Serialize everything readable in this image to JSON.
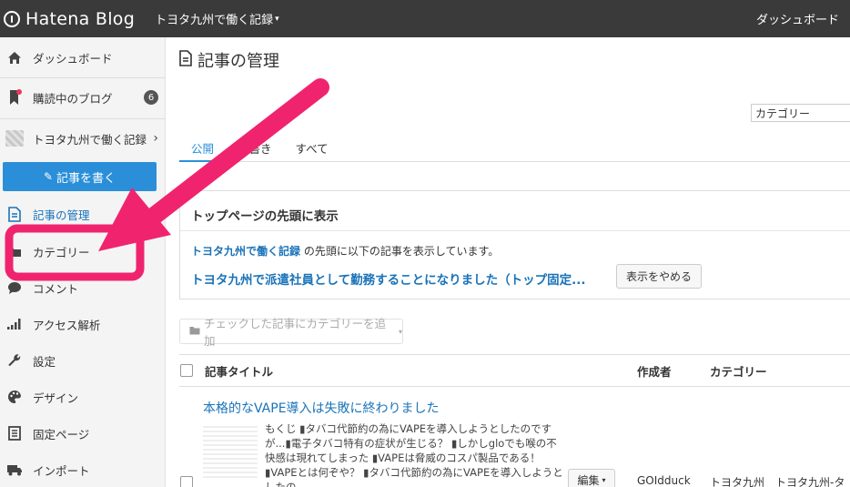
{
  "header": {
    "logo_text": "Hatena Blog",
    "blog_name": "トヨタ九州で働く記録",
    "dashboard_link": "ダッシュボード"
  },
  "sidebar": {
    "items": [
      {
        "label": "ダッシュボード",
        "icon": "home-icon"
      },
      {
        "label": "購読中のブログ",
        "icon": "bookmark-icon",
        "badge": "6"
      },
      {
        "label": "トヨタ九州で働く記録",
        "icon": "blog-thumbnail"
      },
      {
        "label": "記事の管理",
        "icon": "document-icon"
      },
      {
        "label": "カテゴリー",
        "icon": "folder-icon"
      },
      {
        "label": "コメント",
        "icon": "comment-icon"
      },
      {
        "label": "アクセス解析",
        "icon": "bar-chart-icon"
      },
      {
        "label": "設定",
        "icon": "wrench-icon"
      },
      {
        "label": "デザイン",
        "icon": "palette-icon"
      },
      {
        "label": "固定ページ",
        "icon": "page-icon"
      },
      {
        "label": "インポート",
        "icon": "truck-icon"
      }
    ],
    "write_button": "記事を書く"
  },
  "main": {
    "page_title": "記事の管理",
    "category_select": "カテゴリー",
    "tabs": [
      "公開",
      "下書き",
      "すべて"
    ],
    "top_box": {
      "heading": "トップページの先頭に表示",
      "desc_link": "トヨタ九州で働く記録",
      "desc_rest": " の先頭に以下の記事を表示しています。",
      "pinned_title": "トヨタ九州で派遣社員として勤務することになりました（トップ固定...",
      "stop_button": "表示をやめる"
    },
    "bulk_category_button": "チェックした記事にカテゴリーを追加",
    "table": {
      "headers": {
        "title": "記事タイトル",
        "author": "作成者",
        "category": "カテゴリー"
      },
      "rows": [
        {
          "title": "本格的なVAPE導入は失敗に終わりました",
          "excerpt": "もくじ ▮タバコ代節約の為にVAPEを導入しようとしたのですが...▮電子タバコ特有の症状が生じる？ ▮しかしgloでも喉の不快感は現れてしまった ▮VAPEは脅威のコスパ製品である！ ▮VAPEとは何ぞや？ ▮タバコ代節約の為にVAPEを導入しようとしたの",
          "edit": "編集",
          "author": "GOIdduck",
          "categories": "トヨタ九州　トヨタ九州-タ"
        }
      ]
    }
  },
  "colors": {
    "topbar": "#3a3a3a",
    "accent_blue": "#2a8fd8",
    "annotation_pink": "#f0246e"
  }
}
